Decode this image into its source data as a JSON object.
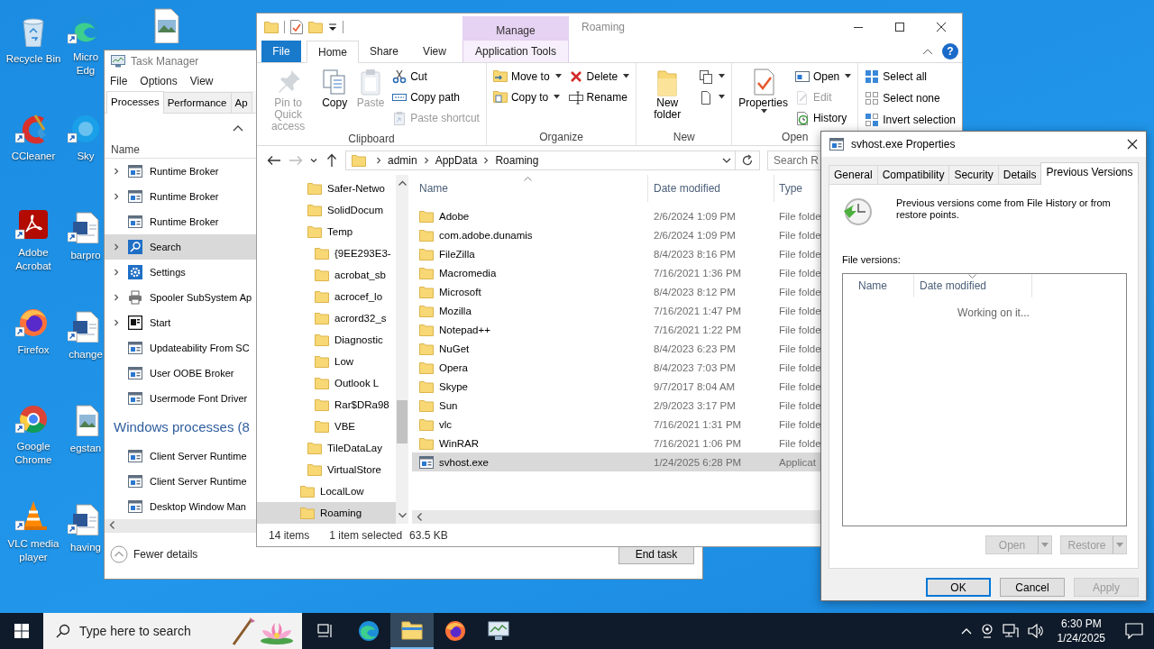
{
  "desktop": {
    "icons": [
      {
        "lines": [
          "Recycle Bin"
        ]
      },
      {
        "lines": [
          "CCleaner"
        ]
      },
      {
        "lines": [
          "Adobe",
          "Acrobat"
        ]
      },
      {
        "lines": [
          "Firefox"
        ]
      },
      {
        "lines": [
          "Google",
          "Chrome"
        ]
      },
      {
        "lines": [
          "VLC media",
          "player"
        ]
      },
      {
        "lines": [
          "Micro",
          "Edg"
        ]
      },
      {
        "lines": [
          "Sky"
        ]
      },
      {
        "lines": [
          "barpro"
        ]
      },
      {
        "lines": [
          "change"
        ]
      },
      {
        "lines": [
          "egstan"
        ]
      },
      {
        "lines": [
          "having"
        ]
      }
    ]
  },
  "task_manager": {
    "title": "Task Manager",
    "menu": [
      "File",
      "Options",
      "View"
    ],
    "tabs": [
      {
        "label": "Processes",
        "selected": true
      },
      {
        "label": "Performance",
        "selected": false
      },
      {
        "label": "Ap",
        "selected": false
      }
    ],
    "column": "Name",
    "rows": [
      {
        "name": "Runtime Broker",
        "kind": "app",
        "expandable": true,
        "selected": false
      },
      {
        "name": "Runtime Broker",
        "kind": "app",
        "expandable": true,
        "selected": false
      },
      {
        "name": "Runtime Broker",
        "kind": "app",
        "expandable": false,
        "selected": false
      },
      {
        "name": "Search",
        "kind": "search",
        "expandable": true,
        "selected": true
      },
      {
        "name": "Settings",
        "kind": "settings",
        "expandable": true,
        "selected": false
      },
      {
        "name": "Spooler SubSystem Ap",
        "kind": "printer",
        "expandable": true,
        "selected": false
      },
      {
        "name": "Start",
        "kind": "start",
        "expandable": true,
        "selected": false
      },
      {
        "name": "Updateability From SC",
        "kind": "app",
        "expandable": false,
        "selected": false
      },
      {
        "name": "User OOBE Broker",
        "kind": "app",
        "expandable": false,
        "selected": false
      },
      {
        "name": "Usermode Font Driver",
        "kind": "app",
        "expandable": false,
        "selected": false
      }
    ],
    "group": "Windows processes (8",
    "group_rows": [
      {
        "name": "Client Server Runtime",
        "kind": "app",
        "expandable": false,
        "selected": false
      },
      {
        "name": "Client Server Runtime",
        "kind": "app",
        "expandable": false,
        "selected": false
      },
      {
        "name": "Desktop Window Man",
        "kind": "app",
        "expandable": false,
        "selected": false
      }
    ],
    "toggle": "Fewer details",
    "end_task": "End task"
  },
  "explorer": {
    "title": "Roaming",
    "context_header": "Manage",
    "help": "?",
    "ribbon_tabs": [
      {
        "label": "File",
        "kind": "menu",
        "selected": false
      },
      {
        "label": "Home",
        "kind": "tab",
        "selected": true
      },
      {
        "label": "Share",
        "kind": "tab",
        "selected": false
      },
      {
        "label": "View",
        "kind": "tab",
        "selected": false
      },
      {
        "label": "Application Tools",
        "kind": "context",
        "selected": false
      }
    ],
    "groups": [
      {
        "label": "Clipboard",
        "columns": [
          [
            {
              "label": "Pin to Quick access",
              "kind": "large",
              "disabled": true
            }
          ],
          [
            {
              "label": "Copy",
              "kind": "large",
              "disabled": false
            }
          ],
          [
            {
              "label": "Paste",
              "kind": "large",
              "disabled": true
            }
          ],
          [
            {
              "label": "Cut",
              "kind": "small",
              "disabled": false
            },
            {
              "label": "Copy path",
              "kind": "small",
              "disabled": false
            },
            {
              "label": "Paste shortcut",
              "kind": "small",
              "disabled": true
            }
          ]
        ]
      },
      {
        "label": "Organize",
        "columns": [
          [
            {
              "label": "Move to",
              "kind": "small",
              "disabled": false,
              "menu": true
            },
            {
              "label": "Copy to",
              "kind": "small",
              "disabled": false,
              "menu": true
            }
          ],
          [
            {
              "label": "Delete",
              "kind": "small",
              "disabled": false,
              "menu": true
            },
            {
              "label": "Rename",
              "kind": "small",
              "disabled": false
            }
          ]
        ]
      },
      {
        "label": "New",
        "columns": [
          [
            {
              "label": "New folder",
              "kind": "large",
              "disabled": false
            }
          ],
          [
            {
              "kind": "small",
              "disabled": false,
              "menu": true
            },
            {
              "kind": "small",
              "disabled": false,
              "menu": true
            }
          ]
        ]
      },
      {
        "label": "Open",
        "columns": [
          [
            {
              "label": "Properties",
              "kind": "large",
              "disabled": false,
              "menu": true
            }
          ],
          [
            {
              "label": "Open",
              "kind": "small",
              "disabled": false,
              "menu": true
            },
            {
              "label": "Edit",
              "kind": "small",
              "disabled": true
            },
            {
              "label": "History",
              "kind": "small",
              "disabled": false
            }
          ]
        ]
      },
      {
        "columns": [
          [
            {
              "label": "Select all",
              "kind": "small",
              "disabled": false
            },
            {
              "label": "Select none",
              "kind": "small",
              "disabled": false
            },
            {
              "label": "Invert selection",
              "kind": "small",
              "disabled": false
            }
          ]
        ]
      }
    ],
    "path": [
      "admin",
      "AppData",
      "Roaming"
    ],
    "search": {
      "placeholder": "Search R"
    },
    "nav": [
      {
        "children": [
          {
            "label": "Safer-Netwo",
            "selected": false
          },
          {
            "label": "SolidDocum",
            "selected": false
          },
          {
            "label": "Temp",
            "selected": false,
            "children": [
              {
                "label": "{9EE293E3-",
                "selected": false
              },
              {
                "label": "acrobat_sb",
                "selected": false
              },
              {
                "label": "acrocef_lo",
                "selected": false
              },
              {
                "label": "acrord32_s",
                "selected": false
              },
              {
                "label": "Diagnostic",
                "selected": false
              },
              {
                "label": "Low",
                "selected": false
              },
              {
                "label": "Outlook L",
                "selected": false
              },
              {
                "label": "Rar$DRa98",
                "selected": false
              },
              {
                "label": "VBE",
                "selected": false
              }
            ]
          },
          {
            "label": "TileDataLay",
            "selected": false
          },
          {
            "label": "VirtualStore",
            "selected": false
          }
        ]
      },
      {
        "label": "LocalLow",
        "selected": false
      },
      {
        "label": "Roaming",
        "selected": true
      }
    ],
    "columns": [
      "Name",
      "Date modified",
      "Type"
    ],
    "files": [
      {
        "name": "Adobe",
        "date": "2/6/2024 1:09 PM",
        "type": "File folde",
        "kind": "folder",
        "selected": false
      },
      {
        "name": "com.adobe.dunamis",
        "date": "2/6/2024 1:09 PM",
        "type": "File folde",
        "kind": "folder",
        "selected": false
      },
      {
        "name": "FileZilla",
        "date": "8/4/2023 8:16 PM",
        "type": "File folde",
        "kind": "folder",
        "selected": false
      },
      {
        "name": "Macromedia",
        "date": "7/16/2021 1:36 PM",
        "type": "File folde",
        "kind": "folder",
        "selected": false
      },
      {
        "name": "Microsoft",
        "date": "8/4/2023 8:12 PM",
        "type": "File folde",
        "kind": "folder",
        "selected": false
      },
      {
        "name": "Mozilla",
        "date": "7/16/2021 1:47 PM",
        "type": "File folde",
        "kind": "folder",
        "selected": false
      },
      {
        "name": "Notepad++",
        "date": "7/16/2021 1:22 PM",
        "type": "File folde",
        "kind": "folder",
        "selected": false
      },
      {
        "name": "NuGet",
        "date": "8/4/2023 6:23 PM",
        "type": "File folde",
        "kind": "folder",
        "selected": false
      },
      {
        "name": "Opera",
        "date": "8/4/2023 7:03 PM",
        "type": "File folde",
        "kind": "folder",
        "selected": false
      },
      {
        "name": "Skype",
        "date": "9/7/2017 8:04 AM",
        "type": "File folde",
        "kind": "folder",
        "selected": false
      },
      {
        "name": "Sun",
        "date": "2/9/2023 3:17 PM",
        "type": "File folde",
        "kind": "folder",
        "selected": false
      },
      {
        "name": "vlc",
        "date": "7/16/2021 1:31 PM",
        "type": "File folde",
        "kind": "folder",
        "selected": false
      },
      {
        "name": "WinRAR",
        "date": "7/16/2021 1:06 PM",
        "type": "File folde",
        "kind": "folder",
        "selected": false
      },
      {
        "name": "svhost.exe",
        "date": "1/24/2025 6:28 PM",
        "type": "Applicat",
        "kind": "app",
        "selected": true
      }
    ],
    "status": {
      "count": "14 items",
      "selection": "1 item selected",
      "size": "63.5 KB"
    }
  },
  "properties_dialog": {
    "title": "svhost.exe Properties",
    "tabs": [
      {
        "label": "General",
        "selected": false
      },
      {
        "label": "Compatibility",
        "selected": false
      },
      {
        "label": "Security",
        "selected": false
      },
      {
        "label": "Details",
        "selected": false
      },
      {
        "label": "Previous Versions",
        "selected": true
      }
    ],
    "description": "Previous versions come from File History or from restore points.",
    "list_label": "File versions:",
    "columns": [
      "Name",
      "Date modified"
    ],
    "status": "Working on it...",
    "actions": [
      {
        "label": "Open",
        "disabled": true
      },
      {
        "label": "Restore",
        "disabled": true
      }
    ],
    "buttons": [
      {
        "label": "OK",
        "disabled": false,
        "default": true
      },
      {
        "label": "Cancel",
        "disabled": false,
        "default": false
      },
      {
        "label": "Apply",
        "disabled": true,
        "default": false
      }
    ]
  },
  "taskbar": {
    "search": {
      "placeholder": "Type here to search"
    },
    "apps": [
      {
        "active": false
      },
      {
        "active": true
      },
      {
        "active": false
      },
      {
        "active": false
      }
    ],
    "time": "6:30 PM",
    "date": "1/24/2025"
  }
}
